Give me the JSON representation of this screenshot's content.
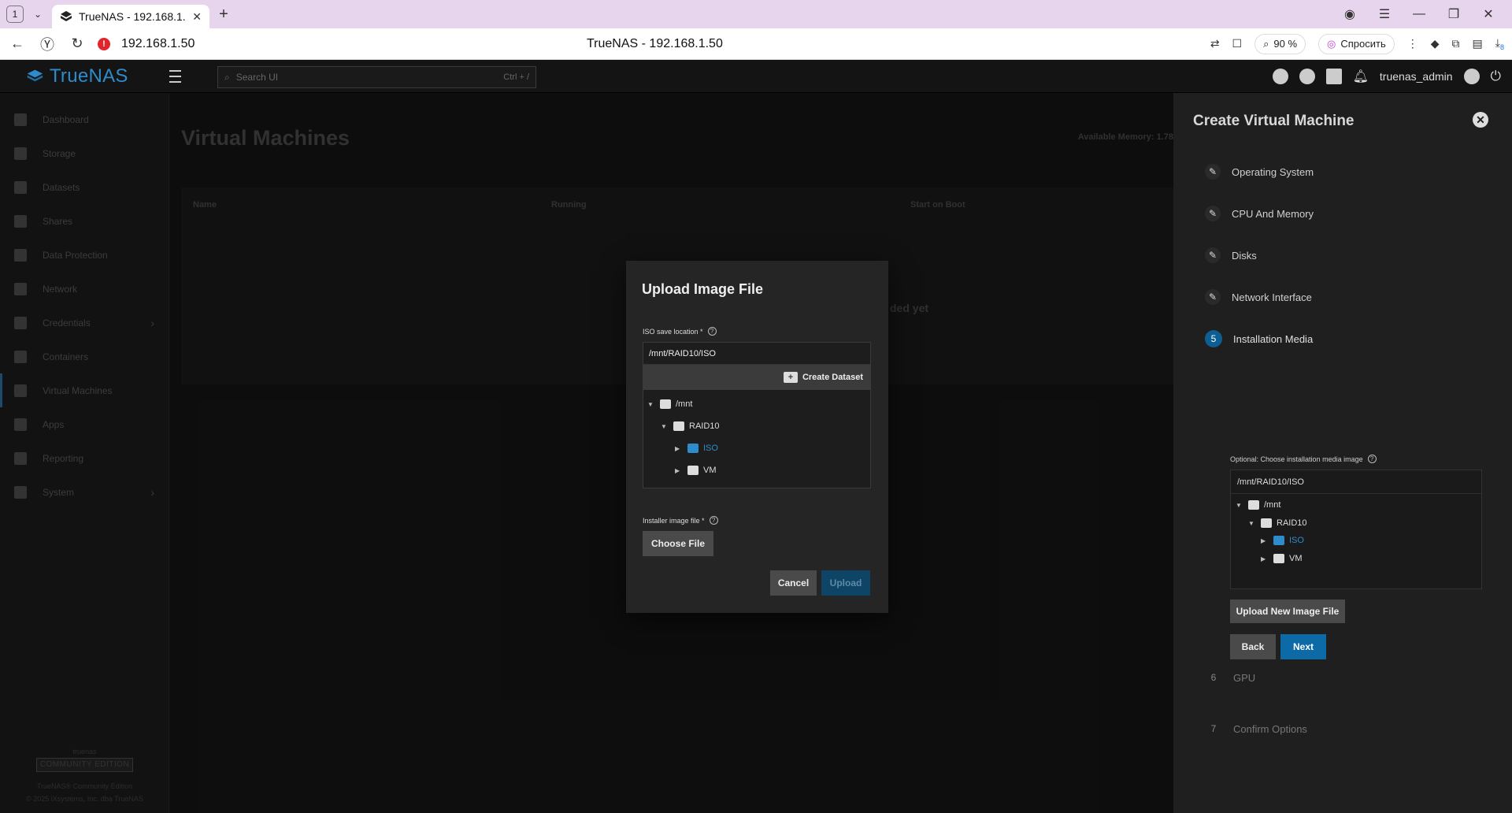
{
  "browser": {
    "tab_count": "1",
    "tab_title": "TrueNAS - 192.168.1.50",
    "url": "192.168.1.50",
    "page_title": "TrueNAS - 192.168.1.50",
    "zoom": "90 %",
    "ask_label": "Спросить",
    "downloads_badge": "8"
  },
  "app": {
    "logo_text": "TrueNAS",
    "search_placeholder": "Search UI",
    "search_shortcut": "Ctrl + /",
    "username": "truenas_admin"
  },
  "sidebar": {
    "items": [
      {
        "label": "Dashboard",
        "icon": "dashboard-icon"
      },
      {
        "label": "Storage",
        "icon": "storage-icon"
      },
      {
        "label": "Datasets",
        "icon": "datasets-icon"
      },
      {
        "label": "Shares",
        "icon": "shares-icon"
      },
      {
        "label": "Data Protection",
        "icon": "shield-icon"
      },
      {
        "label": "Network",
        "icon": "network-icon"
      },
      {
        "label": "Credentials",
        "icon": "key-icon"
      },
      {
        "label": "Containers",
        "icon": "containers-icon"
      },
      {
        "label": "Virtual Machines",
        "icon": "monitor-icon"
      },
      {
        "label": "Apps",
        "icon": "apps-icon"
      },
      {
        "label": "Reporting",
        "icon": "chart-icon"
      },
      {
        "label": "System",
        "icon": "gear-icon"
      }
    ],
    "footer_hostname": "truenas",
    "footer_badge": "COMMUNITY EDITION",
    "footer_edition": "TrueNAS® Community Edition",
    "footer_copyright": "© 2025 iXsystems, Inc. dba TrueNAS"
  },
  "main": {
    "title": "Virtual Machines",
    "available_memory": "Available Memory: 1.78",
    "columns": [
      "Name",
      "Running",
      "Start on Boot"
    ],
    "empty_text": "ded yet"
  },
  "panel": {
    "title": "Create Virtual Machine",
    "steps": [
      {
        "label": "Operating System",
        "state": "done"
      },
      {
        "label": "CPU And Memory",
        "state": "done"
      },
      {
        "label": "Disks",
        "state": "done"
      },
      {
        "label": "Network Interface",
        "state": "done"
      },
      {
        "num": "5",
        "label": "Installation Media",
        "state": "active"
      },
      {
        "num": "6",
        "label": "GPU",
        "state": "pending"
      },
      {
        "num": "7",
        "label": "Confirm Options",
        "state": "pending"
      }
    ],
    "media_label": "Optional: Choose installation media image",
    "media_path": "/mnt/RAID10/ISO",
    "tree": [
      "/mnt",
      "RAID10",
      "ISO",
      "VM"
    ],
    "upload_new_label": "Upload New Image File",
    "back_label": "Back",
    "next_label": "Next"
  },
  "modal": {
    "title": "Upload Image File",
    "iso_location_label": "ISO save location *",
    "iso_location_value": "/mnt/RAID10/ISO",
    "create_dataset_label": "Create Dataset",
    "tree": [
      "/mnt",
      "RAID10",
      "ISO",
      "VM"
    ],
    "installer_label": "Installer image file *",
    "choose_file_label": "Choose File",
    "cancel_label": "Cancel",
    "upload_label": "Upload"
  },
  "colors": {
    "accent": "#2e8ccc",
    "primary_button": "#0c6aa6",
    "background": "#121212"
  }
}
